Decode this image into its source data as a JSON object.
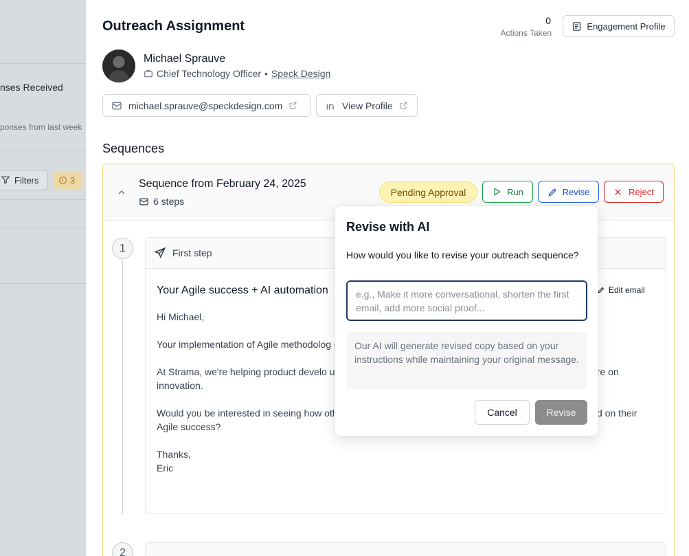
{
  "left_panel": {
    "responses_title": "nses Received",
    "responses_sub": "ponses from last week",
    "filters_label": "Filters",
    "warning_count": "3"
  },
  "header": {
    "title": "Outreach Assignment",
    "actions_count": "0",
    "actions_label": "Actions Taken",
    "engagement_button": "Engagement Profile"
  },
  "contact": {
    "name": "Michael Sprauve",
    "role": "Chief Technology Officer",
    "separator": "•",
    "company": "Speck Design",
    "email": "michael.sprauve@speckdesign.com",
    "profile_label": "View Profile"
  },
  "sequences": {
    "heading": "Sequences",
    "sequence": {
      "title": "Sequence from February 24, 2025",
      "steps_label": "6 steps",
      "status": "Pending Approval",
      "run_label": "Run",
      "revise_label": "Revise",
      "reject_label": "Reject",
      "status_color": "#fdf3b4"
    },
    "steps": [
      {
        "number": "1",
        "label": "First step",
        "subject": "Your Agile success + AI automation",
        "edit_label": "Edit email",
        "body": [
          "Hi Michael,",
          "Your implementation of Agile methodolog                                                                          ght my attention. That's impressive leadership.",
          "At Strama, we're helping product develo                                                                         ugh AI-powered automation that reduces admin                                                                    ns to focus more on innovation.",
          "Would you be interested in seeing how other technology innovation leaders are using automation to build on their Agile success?",
          "Thanks,",
          "Eric"
        ]
      },
      {
        "number": "2"
      }
    ]
  },
  "revise_popover": {
    "title": "Revise with AI",
    "question": "How would you like to revise your outreach sequence?",
    "placeholder": "e.g., Make it more conversational, shorten the first email, add more social proof...",
    "note": "Our AI will generate revised copy based on your instructions while maintaining your original message.",
    "cancel_label": "Cancel",
    "submit_label": "Revise"
  }
}
